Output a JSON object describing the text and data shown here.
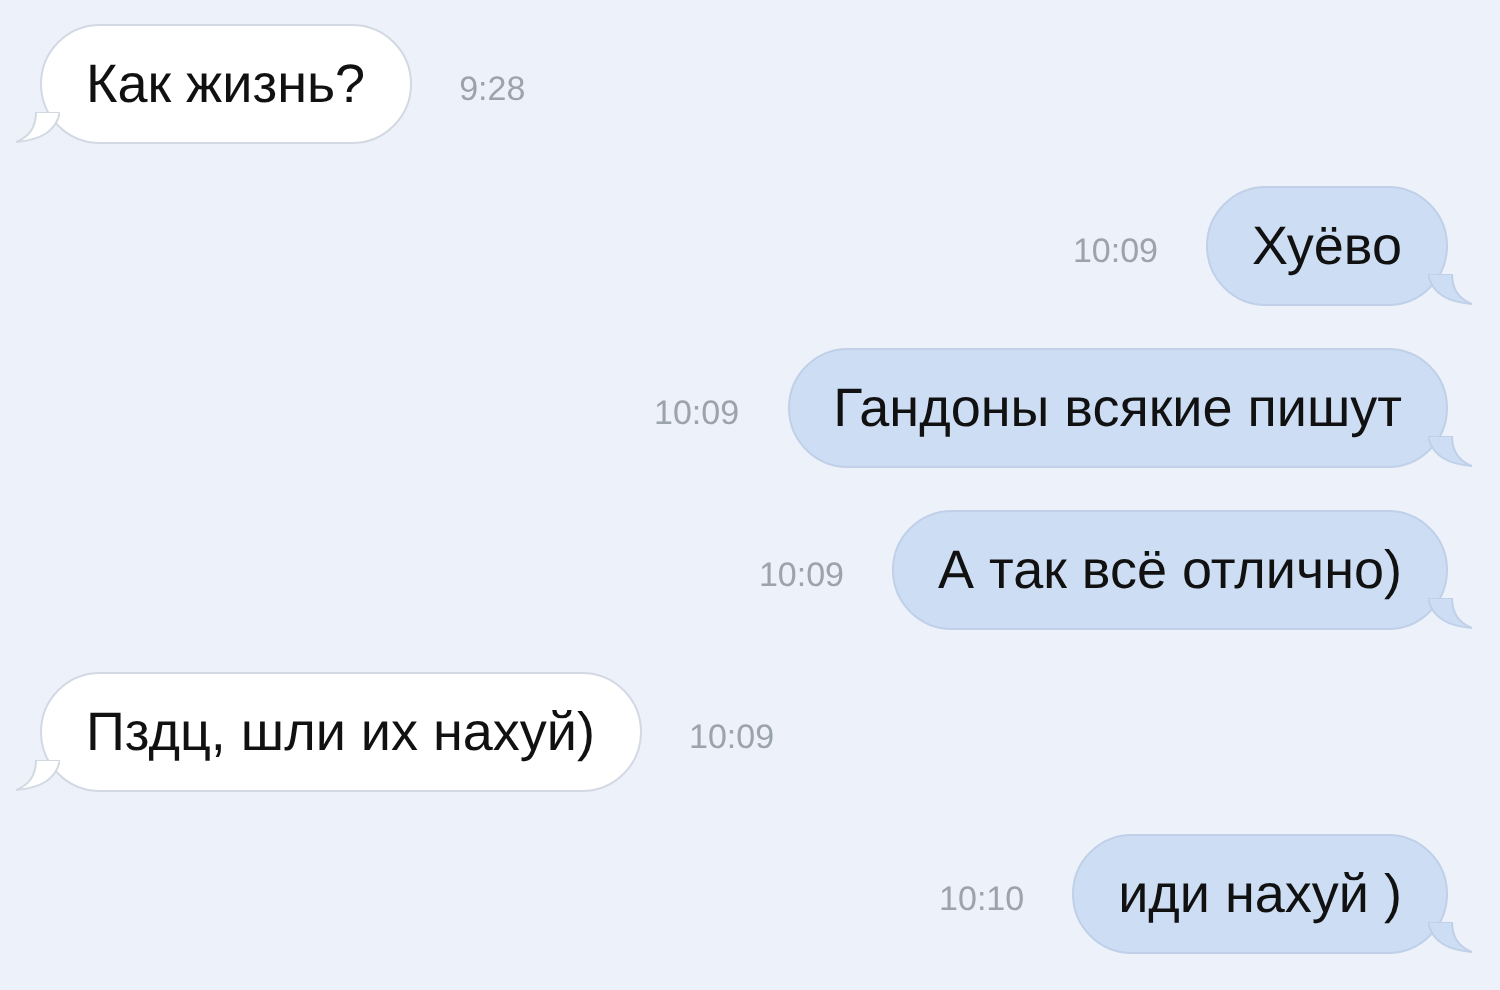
{
  "messages": [
    {
      "outgoing": false,
      "text": "Как жизнь?",
      "time": "9:28"
    },
    {
      "outgoing": true,
      "text": "Хуёво",
      "time": "10:09"
    },
    {
      "outgoing": true,
      "text": "Гандоны всякие пишут",
      "time": "10:09"
    },
    {
      "outgoing": true,
      "text": "А так всё отлично)",
      "time": "10:09"
    },
    {
      "outgoing": false,
      "text": "Пздц, шли их нахуй)",
      "time": "10:09"
    },
    {
      "outgoing": true,
      "text": "иди нахуй )",
      "time": "10:10"
    }
  ]
}
